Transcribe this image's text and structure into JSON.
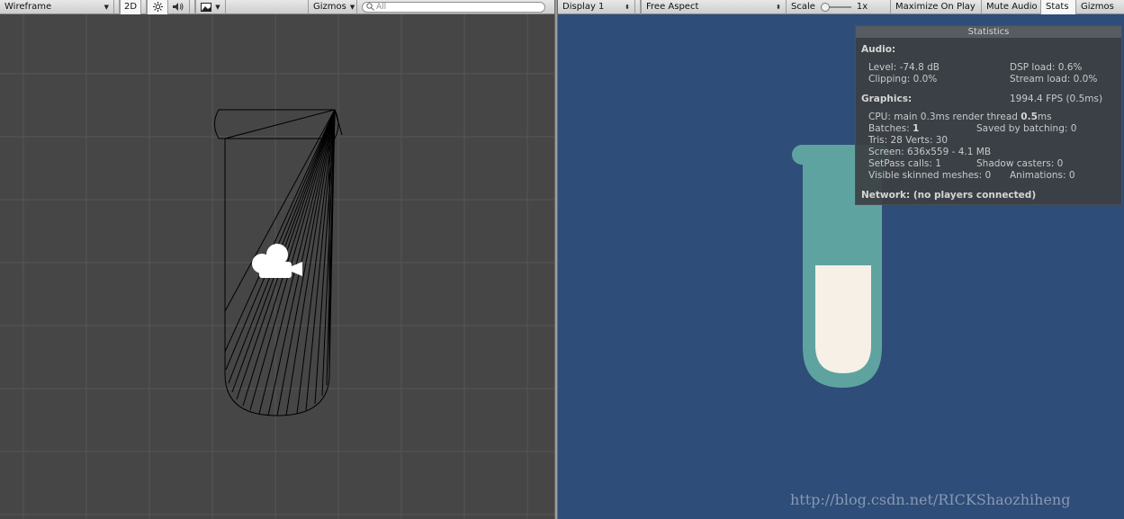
{
  "scene_toolbar": {
    "shading_mode": "Wireframe",
    "mode_2d": "2D",
    "lighting_icon": "sun-icon",
    "audio_icon": "speaker-icon",
    "effects_icon": "image-icon",
    "gizmos_label": "Gizmos",
    "search_placeholder": "All",
    "search_icon": "search-icon"
  },
  "game_toolbar": {
    "display": "Display 1",
    "aspect": "Free Aspect",
    "scale_label": "Scale",
    "scale_value": "1x",
    "scale_fraction": 0.0,
    "maximize": "Maximize On Play",
    "mute": "Mute Audio",
    "stats": "Stats",
    "gizmos": "Gizmos"
  },
  "scene": {
    "camera_icon": "camera-icon",
    "grid_color": "#555555",
    "background_color": "#464646"
  },
  "game": {
    "background_color": "#2e4d78",
    "tube_color": "#5fa3a0",
    "liquid_color": "#f6f0e6"
  },
  "stats": {
    "title": "Statistics",
    "audio_heading": "Audio:",
    "audio_level": "Level: -74.8 dB",
    "dsp_load": "DSP load: 0.6%",
    "clipping": "Clipping: 0.0%",
    "stream_load": "Stream load: 0.0%",
    "graphics_heading": "Graphics:",
    "fps": "1994.4 FPS (0.5ms)",
    "cpu_prefix": "CPU: main 0.3ms  render thread ",
    "cpu_render": "0.5",
    "cpu_suffix": "ms",
    "batches_label": "Batches: ",
    "batches_value": "1",
    "saved_batching": "Saved by batching: 0",
    "tris_verts": "Tris: 28   Verts: 30",
    "screen": "Screen: 636x559 - 4.1 MB",
    "setpass": "SetPass calls: 1",
    "shadow_casters": "Shadow casters: 0",
    "skinned_meshes": "Visible skinned meshes: 0",
    "animations": "Animations: 0",
    "network": "Network: (no players connected)"
  },
  "watermark": "http://blog.csdn.net/RICKShaozhiheng"
}
